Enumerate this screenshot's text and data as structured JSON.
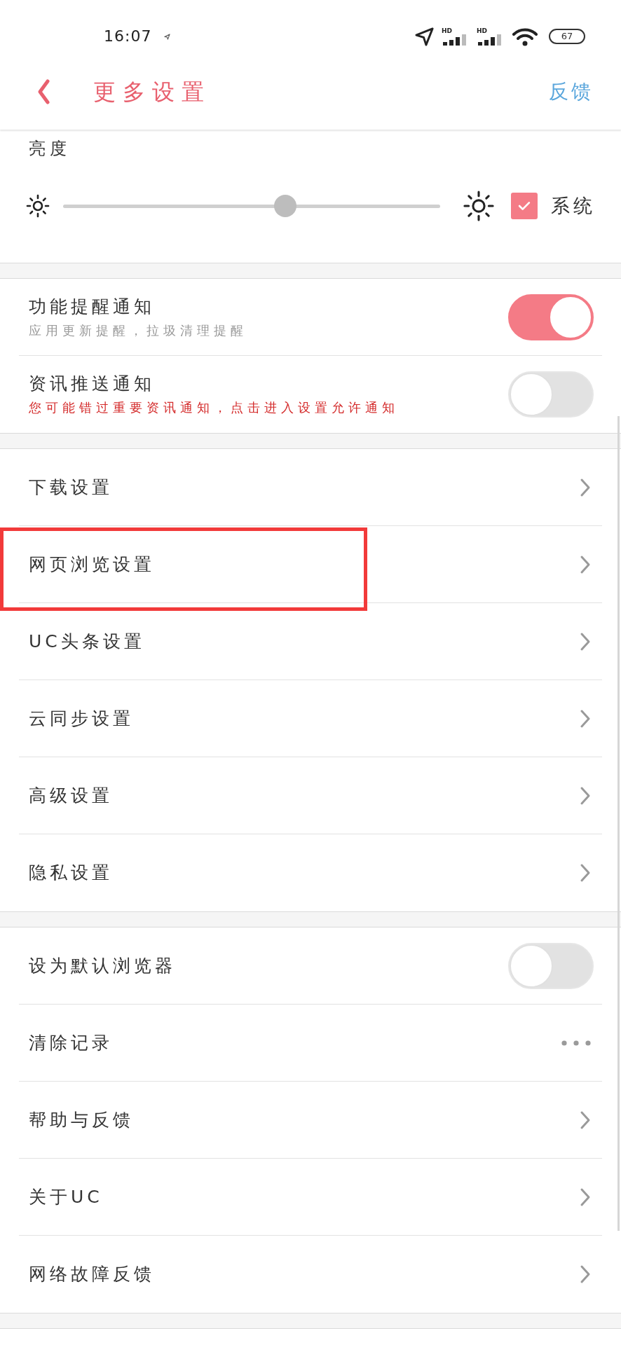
{
  "status_bar": {
    "time": "16:07",
    "signals": [
      {
        "label": "HD"
      },
      {
        "label": "HD"
      }
    ],
    "battery": "67"
  },
  "header": {
    "title": "更多设置",
    "action": "反馈"
  },
  "brightness": {
    "label": "亮度",
    "level": 0.59,
    "system": {
      "label": "系统",
      "checked": true
    }
  },
  "notifications": [
    {
      "title": "功能提醒通知",
      "description": "应用更新提醒，拉圾清理提醒",
      "warning": false,
      "on": true
    },
    {
      "title": "资讯推送通知",
      "description": "您可能错过重要资讯通知，点击进入设置允许通知",
      "warning": true,
      "on": false
    }
  ],
  "groups": [
    {
      "items": [
        {
          "kind": "link",
          "label": "下载设置",
          "highlighted": false
        },
        {
          "kind": "link",
          "label": "网页浏览设置",
          "highlighted": true
        },
        {
          "kind": "link",
          "label": "UC头条设置",
          "highlighted": false
        },
        {
          "kind": "link",
          "label": "云同步设置",
          "highlighted": false
        },
        {
          "kind": "link",
          "label": "高级设置",
          "highlighted": false
        },
        {
          "kind": "link",
          "label": "隐私设置",
          "highlighted": false
        }
      ]
    },
    {
      "items": [
        {
          "kind": "toggle",
          "label": "设为默认浏览器",
          "on": false,
          "highlighted": false
        },
        {
          "kind": "menu",
          "label": "清除记录",
          "highlighted": false
        },
        {
          "kind": "link",
          "label": "帮助与反馈",
          "highlighted": false
        },
        {
          "kind": "link",
          "label": "关于UC",
          "highlighted": false
        },
        {
          "kind": "link",
          "label": "网络故障反馈",
          "highlighted": false
        }
      ]
    }
  ]
}
